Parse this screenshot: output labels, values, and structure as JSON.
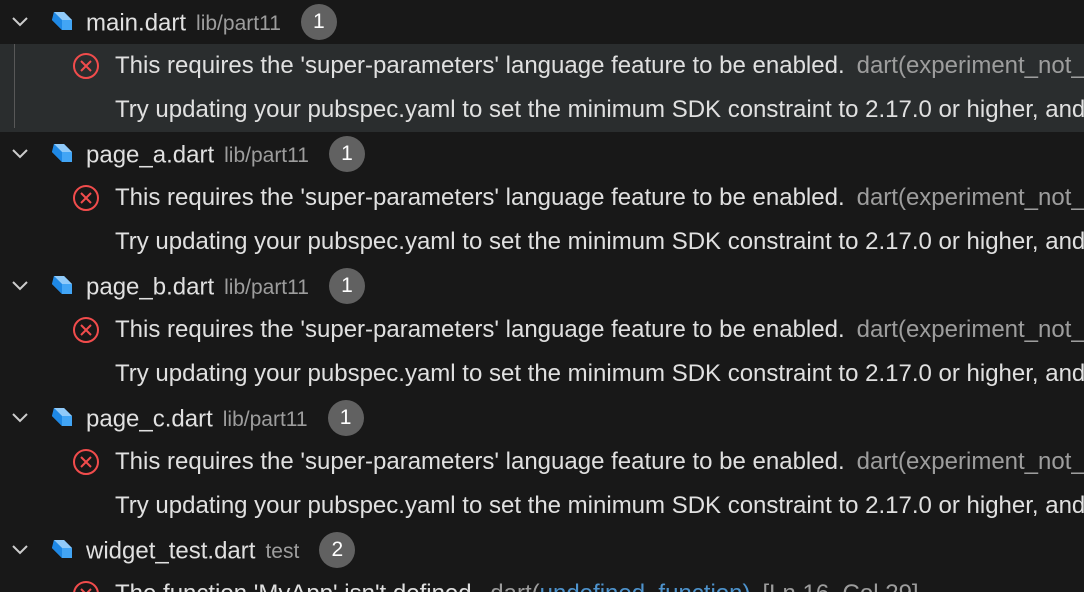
{
  "groups": [
    {
      "file": "main.dart",
      "path": "lib/part11",
      "count": "1",
      "error": "This requires the 'super-parameters' language feature to be enabled.",
      "code": "dart(experiment_not_enabled)",
      "hint": "Try updating your pubspec.yaml to set the minimum SDK constraint to 2.17.0 or higher, and running 'pub get'."
    },
    {
      "file": "page_a.dart",
      "path": "lib/part11",
      "count": "1",
      "error": "This requires the 'super-parameters' language feature to be enabled.",
      "code": "dart(experiment_not_enabled)",
      "hint": "Try updating your pubspec.yaml to set the minimum SDK constraint to 2.17.0 or higher, and running 'pub get'."
    },
    {
      "file": "page_b.dart",
      "path": "lib/part11",
      "count": "1",
      "error": "This requires the 'super-parameters' language feature to be enabled.",
      "code": "dart(experiment_not_enabled)",
      "hint": "Try updating your pubspec.yaml to set the minimum SDK constraint to 2.17.0 or higher, and running 'pub get'."
    },
    {
      "file": "page_c.dart",
      "path": "lib/part11",
      "count": "1",
      "error": "This requires the 'super-parameters' language feature to be enabled.",
      "code": "dart(experiment_not_enabled)",
      "hint": "Try updating your pubspec.yaml to set the minimum SDK constraint to 2.17.0 or higher, and running 'pub get'."
    },
    {
      "file": "widget_test.dart",
      "path": "test",
      "count": "2",
      "error": "The function 'MyApp' isn't defined.",
      "code_prefix": "dart(",
      "code_link": "undefined_function",
      "code_suffix": ")",
      "position": "[Ln 16, Col 29]"
    }
  ],
  "colors": {
    "background": "#181818",
    "selection": "#2a2d2e",
    "error": "#f14c4c",
    "dart_icon": "#42a5f5",
    "badge": "#616161",
    "link": "#4e94ce"
  },
  "icons": {
    "expand": "chevron-down-icon",
    "file": "dart-file-icon",
    "error": "error-circle-icon"
  }
}
